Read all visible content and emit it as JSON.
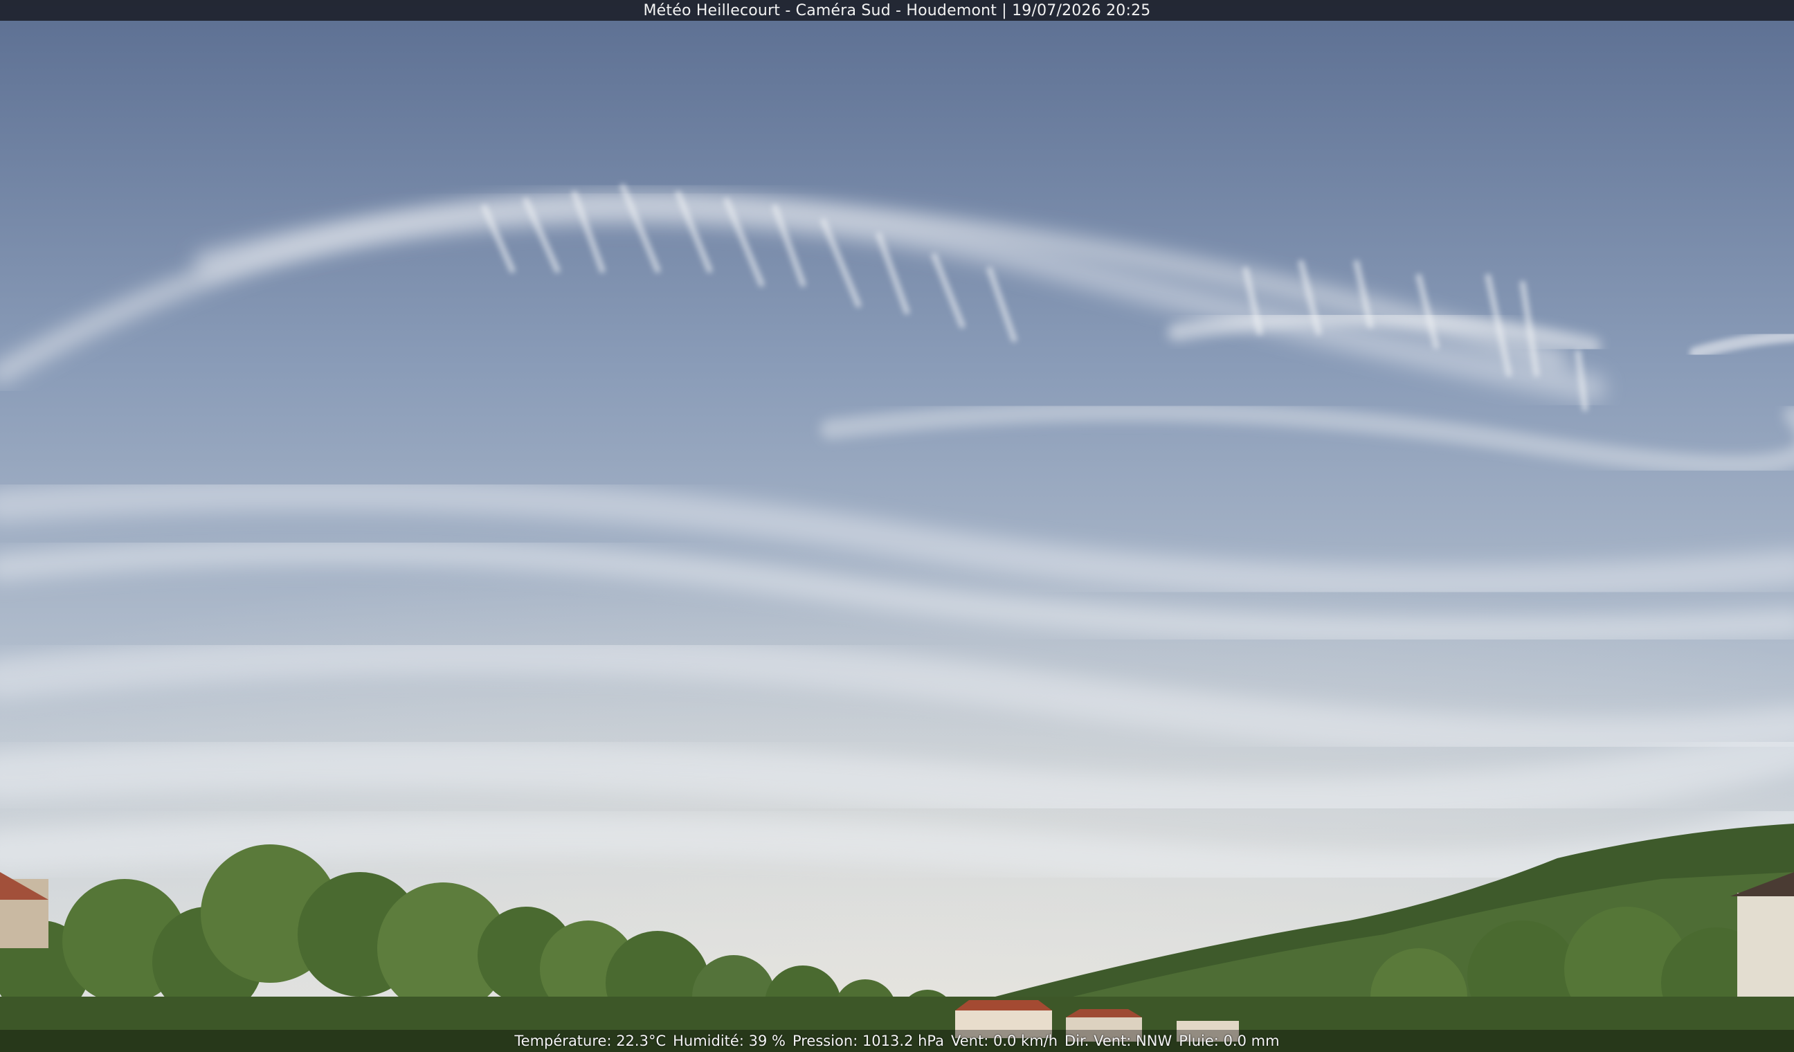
{
  "header": {
    "title": "Météo Heillecourt - Caméra Sud - Houdemont | 19/07/2026 20:25"
  },
  "scene": {
    "description_icon": "webcam-sky-scene",
    "sky_color_top": "#5f7396",
    "sky_color_bottom": "#d9dde3"
  },
  "footer": {
    "temperature": "Température: 22.3°C",
    "humidity": "Humidité: 39 %",
    "pressure": "Pression: 1013.2 hPa",
    "wind": "Vent: 0.0 km/h",
    "wind_dir": "Dir. Vent: NNW",
    "rain": "Pluie: 0.0 mm"
  }
}
